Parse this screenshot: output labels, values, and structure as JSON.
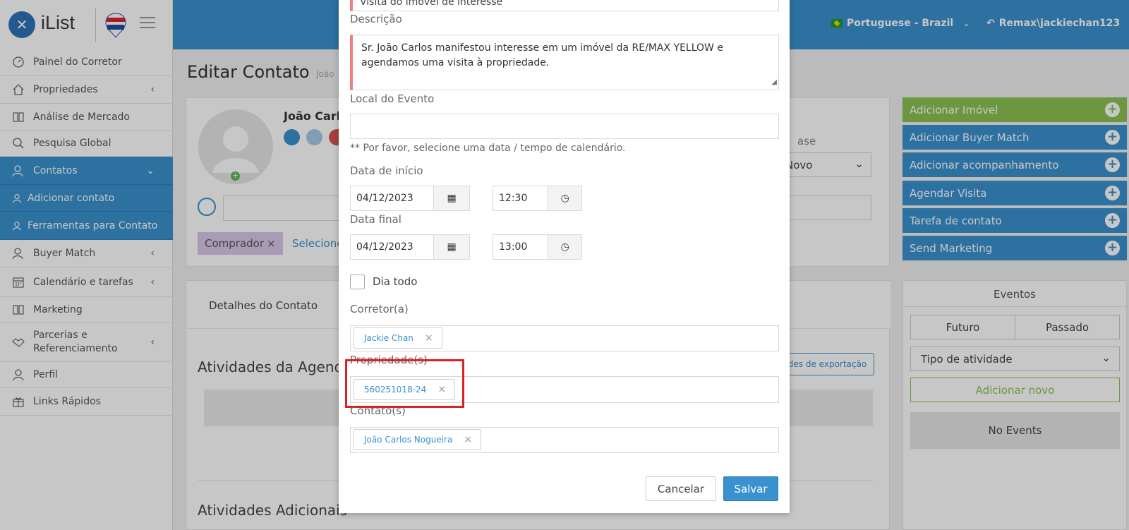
{
  "app": {
    "name": "iList",
    "logo_badge": "RE/MAX"
  },
  "header": {
    "language": "Portuguese - Brazil",
    "user": "Remax\\jackiechan123"
  },
  "sidebar": {
    "items": [
      {
        "label": "Painel do Corretor",
        "icon": "dashboard-icon"
      },
      {
        "label": "Propriedades",
        "icon": "home-icon"
      },
      {
        "label": "Análise de Mercado",
        "icon": "book-icon"
      },
      {
        "label": "Pesquisa Global",
        "icon": "search-icon"
      },
      {
        "label": "Contatos",
        "icon": "users-icon"
      },
      {
        "label": "Adicionar contato",
        "icon": "user-icon"
      },
      {
        "label": "Ferramentas para Contato",
        "icon": "user-icon"
      },
      {
        "label": "Buyer Match",
        "icon": "users-icon"
      },
      {
        "label": "Calendário e tarefas",
        "icon": "calendar-icon"
      },
      {
        "label": "Marketing",
        "icon": "book-icon"
      },
      {
        "label": "Parcerias e Referenciamento",
        "icon": "handshake-icon"
      },
      {
        "label": "Perfil",
        "icon": "user-icon"
      },
      {
        "label": "Links Rápidos",
        "icon": "gift-icon"
      }
    ]
  },
  "page": {
    "title": "Editar Contato",
    "subtitle": "João",
    "contact_name": "João Carlo",
    "buyer_tag": "Comprador",
    "select_link": "Selecione",
    "phase_label": "ase",
    "status_value": "Novo",
    "tab_details": "Detalhes do Contato",
    "section_activities": "Atividades da Agend",
    "export_link": "des de exportação",
    "section_additional": "Atividades Adicionais"
  },
  "actions": [
    {
      "label": "Adicionar Imóvel",
      "color": "#8cc152"
    },
    {
      "label": "Adicionar Buyer Match",
      "color": "#3a91cf"
    },
    {
      "label": "Adicionar acompanhamento",
      "color": "#3a91cf"
    },
    {
      "label": "Agendar Visita",
      "color": "#3a91cf"
    },
    {
      "label": "Tarefa de contato",
      "color": "#3a91cf"
    },
    {
      "label": "Send Marketing",
      "color": "#3a91cf"
    }
  ],
  "events": {
    "title": "Eventos",
    "future": "Futuro",
    "past": "Passado",
    "type_placeholder": "Tipo de atividade",
    "add_new": "Adicionar novo",
    "empty": "No Events"
  },
  "modal": {
    "title_value": "Visita do imóvel de interesse",
    "desc_label": "Descrição",
    "desc_value": "Sr. João Carlos manifestou interesse em um imóvel da RE/MAX YELLOW e agendamos uma visita à propriedade.",
    "location_label": "Local do Evento",
    "location_value": "",
    "date_hint": "** Por favor, selecione uma data / tempo de calendário.",
    "start_label": "Data de início",
    "start_date": "04/12/2023",
    "start_time": "12:30",
    "end_label": "Data final",
    "end_date": "04/12/2023",
    "end_time": "13:00",
    "allday_label": "Dia todo",
    "agent_label": "Corretor(a)",
    "agent_tag": "Jackie Chan",
    "property_label": "Propriedade(s)",
    "property_tag": "560251018-24",
    "contact_label": "Contato(s)",
    "contact_tag": "João Carlos Nogueira",
    "cancel": "Cancelar",
    "save": "Salvar"
  },
  "colors": {
    "primary": "#3a91cf",
    "green": "#8cc152",
    "highlight": "#e02020",
    "tag_purple": "#d9c7e8"
  }
}
